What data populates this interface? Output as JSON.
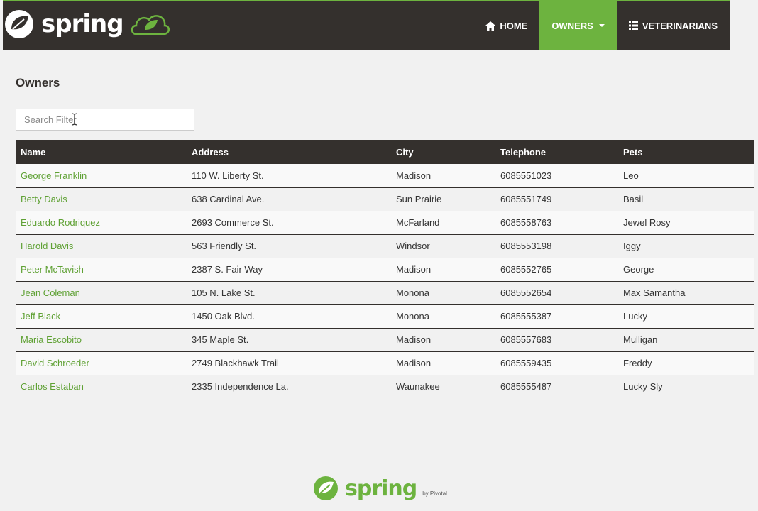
{
  "navbar": {
    "brand": "spring",
    "items": [
      {
        "label": "Home",
        "icon": "home-icon",
        "active": false
      },
      {
        "label": "Owners",
        "icon": "",
        "active": true,
        "dropdown": true
      },
      {
        "label": "Veterinarians",
        "icon": "list-icon",
        "active": false
      }
    ]
  },
  "page": {
    "title": "Owners"
  },
  "search": {
    "placeholder": "Search Filter"
  },
  "table": {
    "columns": [
      "Name",
      "Address",
      "City",
      "Telephone",
      "Pets"
    ],
    "rows": [
      [
        "George Franklin",
        "110 W. Liberty St.",
        "Madison",
        "6085551023",
        "Leo"
      ],
      [
        "Betty Davis",
        "638 Cardinal Ave.",
        "Sun Prairie",
        "6085551749",
        "Basil"
      ],
      [
        "Eduardo Rodriquez",
        "2693 Commerce St.",
        "McFarland",
        "6085558763",
        "Jewel Rosy"
      ],
      [
        "Harold Davis",
        "563 Friendly St.",
        "Windsor",
        "6085553198",
        "Iggy"
      ],
      [
        "Peter McTavish",
        "2387 S. Fair Way",
        "Madison",
        "6085552765",
        "George"
      ],
      [
        "Jean Coleman",
        "105 N. Lake St.",
        "Monona",
        "6085552654",
        "Max Samantha"
      ],
      [
        "Jeff Black",
        "1450 Oak Blvd.",
        "Monona",
        "6085555387",
        "Lucky"
      ],
      [
        "Maria Escobito",
        "345 Maple St.",
        "Madison",
        "6085557683",
        "Mulligan"
      ],
      [
        "David Schroeder",
        "2749 Blackhawk Trail",
        "Madison",
        "6085559435",
        "Freddy"
      ],
      [
        "Carlos Estaban",
        "2335 Independence La.",
        "Waunakee",
        "6085555487",
        "Lucky Sly"
      ]
    ]
  },
  "footer": {
    "brand": "spring",
    "by": "by Pivotal."
  },
  "colors": {
    "brand_green": "#6db33f",
    "dark": "#34302d",
    "background": "#f1f1f1"
  }
}
